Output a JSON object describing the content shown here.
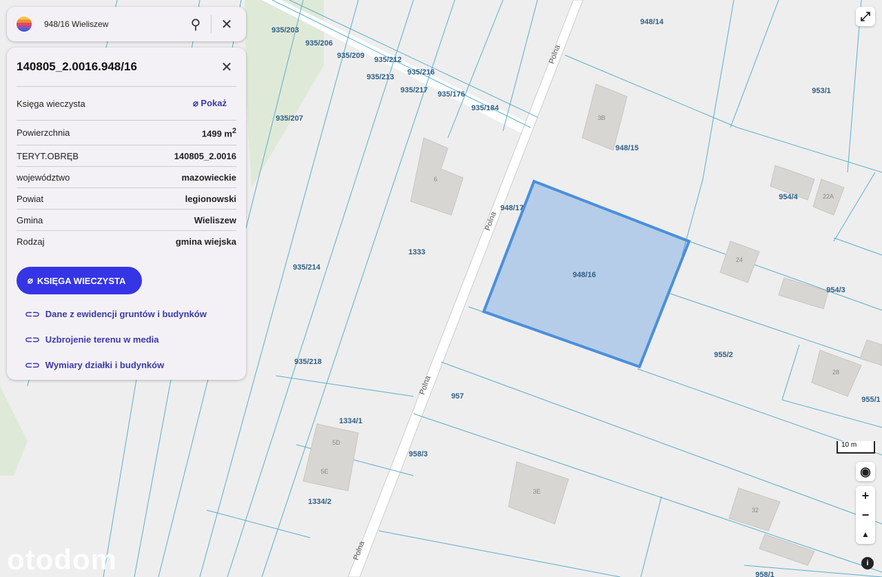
{
  "search": {
    "query": "948/16 Wieliszew"
  },
  "panel": {
    "title": "140805_2.0016.948/16",
    "kw_label": "Księga wieczysta",
    "kw_link": "Pokaż",
    "rows": [
      {
        "label": "Powierzchnia",
        "value": "1499 m",
        "sup": "2"
      },
      {
        "label": "TERYT.OBRĘB",
        "value": "140805_2.0016"
      },
      {
        "label": "województwo",
        "value": "mazowieckie"
      },
      {
        "label": "Powiat",
        "value": "legionowski"
      },
      {
        "label": "Gmina",
        "value": "Wieliszew"
      },
      {
        "label": "Rodzaj",
        "value": "gmina wiejska"
      }
    ],
    "button": "KSIĘGA WIECZYSTA",
    "links": [
      "Dane z ewidencji gruntów i budynków",
      "Uzbrojenie terenu w media",
      "Wymiary działki i budynków"
    ]
  },
  "map": {
    "labels": [
      "948/14",
      "935/203",
      "935/206",
      "935/209",
      "935/212",
      "935/213",
      "935/216",
      "935/217",
      "935/176",
      "935/184",
      "953/1",
      "935/207",
      "948/15",
      "948/17",
      "954/4",
      "1333",
      "935/214",
      "948/16",
      "954/3",
      "955/2",
      "935/218",
      "957",
      "955/1",
      "1334/1",
      "958/3",
      "1334/2",
      "958/1"
    ],
    "buildings": [
      "3B",
      "6",
      "22A",
      "24",
      "28",
      "5D",
      "5E",
      "3E",
      "32"
    ],
    "street": "Polna",
    "scale": "10 m",
    "selected_color": "#4a8fdc"
  },
  "watermark": "otodom"
}
